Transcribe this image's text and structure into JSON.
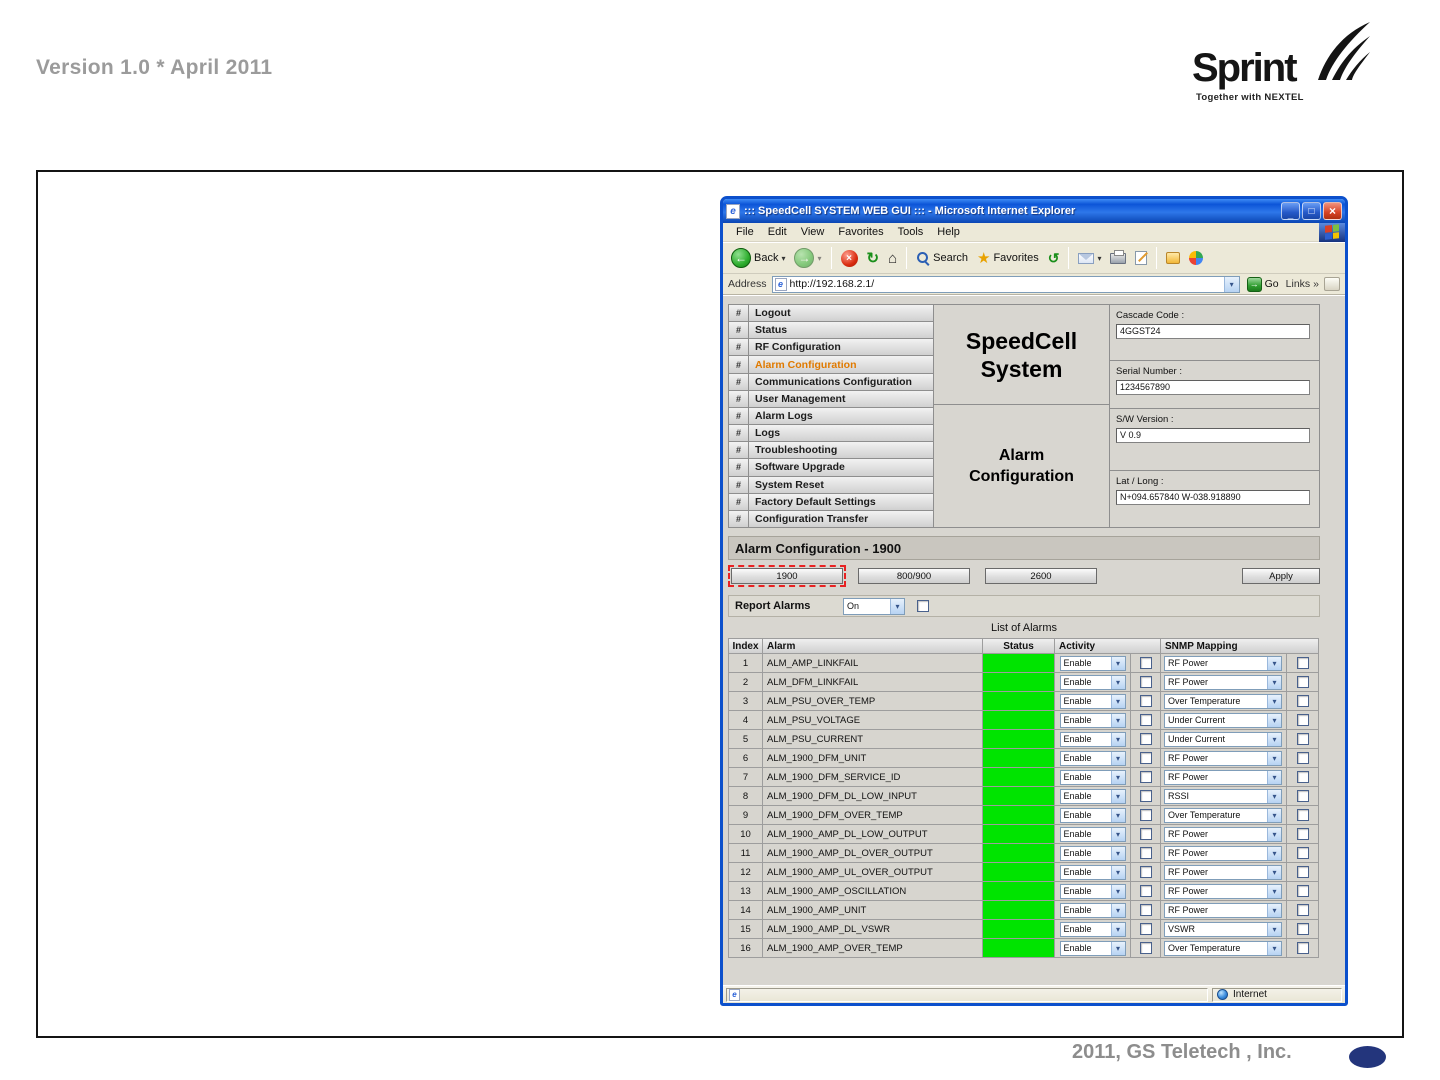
{
  "page": {
    "version_label": "Version 1.0 * April 2011",
    "footer_text": "2011, GS Teletech , Inc.",
    "brand_name": "Sprint",
    "brand_tagline": "Together with NEXTEL"
  },
  "icons": {
    "back_arrow": "←",
    "forward_arrow": "→",
    "stop": "×",
    "refresh": "↻",
    "home": "⌂",
    "favorites_star": "★",
    "history": "↺",
    "dropdown_arrow": "▾",
    "go_arrow": "→",
    "links_chevrons": "»",
    "minimize": "_",
    "maximize": "□",
    "close": "×",
    "ie_letter": "e"
  },
  "browser": {
    "window_title": "::: SpeedCell SYSTEM WEB GUI ::: - Microsoft Internet Explorer",
    "menu_items": [
      "File",
      "Edit",
      "View",
      "Favorites",
      "Tools",
      "Help"
    ],
    "toolbar": {
      "back_label": "Back",
      "search_label": "Search",
      "favorites_label": "Favorites"
    },
    "address_label": "Address",
    "address_url": "http://192.168.2.1/",
    "go_label": "Go",
    "links_label": "Links",
    "status_right": "Internet"
  },
  "nav": {
    "items": [
      {
        "marker": "#",
        "label": "Logout",
        "active": false
      },
      {
        "marker": "#",
        "label": "Status",
        "active": false
      },
      {
        "marker": "#",
        "label": "RF Configuration",
        "active": false
      },
      {
        "marker": "#",
        "label": "Alarm Configuration",
        "active": true
      },
      {
        "marker": "#",
        "label": "Communications Configuration",
        "active": false
      },
      {
        "marker": "#",
        "label": "User Management",
        "active": false
      },
      {
        "marker": "#",
        "label": "Alarm Logs",
        "active": false
      },
      {
        "marker": "#",
        "label": "Logs",
        "active": false
      },
      {
        "marker": "#",
        "label": "Troubleshooting",
        "active": false
      },
      {
        "marker": "#",
        "label": "Software Upgrade",
        "active": false
      },
      {
        "marker": "#",
        "label": "System Reset",
        "active": false
      },
      {
        "marker": "#",
        "label": "Factory Default Settings",
        "active": false
      },
      {
        "marker": "#",
        "label": "Configuration Transfer",
        "active": false
      }
    ]
  },
  "app": {
    "title_line1": "SpeedCell",
    "title_line2": "System",
    "section_line1": "Alarm",
    "section_line2": "Configuration",
    "info_fields": [
      {
        "label": "Cascade Code :",
        "value": "4GGST24"
      },
      {
        "label": "Serial Number :",
        "value": "1234567890"
      },
      {
        "label": "S/W Version :",
        "value": "V 0.9"
      },
      {
        "label": "Lat / Long :",
        "value": "N+094.657840 W-038.918890"
      }
    ]
  },
  "alarm_config": {
    "section_title": "Alarm Configuration - 1900",
    "band_buttons": [
      "1900",
      "800/900",
      "2600"
    ],
    "highlighted_band": "1900",
    "apply_label": "Apply",
    "report_alarms_label": "Report Alarms",
    "report_alarms_value": "On",
    "list_title": "List of Alarms",
    "columns": [
      "Index",
      "Alarm",
      "Status",
      "Activity",
      "SNMP Mapping"
    ],
    "status_color": "#00e400",
    "rows": [
      {
        "index": "1",
        "alarm": "ALM_AMP_LINKFAIL",
        "activity": "Enable",
        "snmp": "RF Power"
      },
      {
        "index": "2",
        "alarm": "ALM_DFM_LINKFAIL",
        "activity": "Enable",
        "snmp": "RF Power"
      },
      {
        "index": "3",
        "alarm": "ALM_PSU_OVER_TEMP",
        "activity": "Enable",
        "snmp": "Over Temperature"
      },
      {
        "index": "4",
        "alarm": "ALM_PSU_VOLTAGE",
        "activity": "Enable",
        "snmp": "Under Current"
      },
      {
        "index": "5",
        "alarm": "ALM_PSU_CURRENT",
        "activity": "Enable",
        "snmp": "Under Current"
      },
      {
        "index": "6",
        "alarm": "ALM_1900_DFM_UNIT",
        "activity": "Enable",
        "snmp": "RF Power"
      },
      {
        "index": "7",
        "alarm": "ALM_1900_DFM_SERVICE_ID",
        "activity": "Enable",
        "snmp": "RF Power"
      },
      {
        "index": "8",
        "alarm": "ALM_1900_DFM_DL_LOW_INPUT",
        "activity": "Enable",
        "snmp": "RSSI"
      },
      {
        "index": "9",
        "alarm": "ALM_1900_DFM_OVER_TEMP",
        "activity": "Enable",
        "snmp": "Over Temperature"
      },
      {
        "index": "10",
        "alarm": "ALM_1900_AMP_DL_LOW_OUTPUT",
        "activity": "Enable",
        "snmp": "RF Power"
      },
      {
        "index": "11",
        "alarm": "ALM_1900_AMP_DL_OVER_OUTPUT",
        "activity": "Enable",
        "snmp": "RF Power"
      },
      {
        "index": "12",
        "alarm": "ALM_1900_AMP_UL_OVER_OUTPUT",
        "activity": "Enable",
        "snmp": "RF Power"
      },
      {
        "index": "13",
        "alarm": "ALM_1900_AMP_OSCILLATION",
        "activity": "Enable",
        "snmp": "RF Power"
      },
      {
        "index": "14",
        "alarm": "ALM_1900_AMP_UNIT",
        "activity": "Enable",
        "snmp": "RF Power"
      },
      {
        "index": "15",
        "alarm": "ALM_1900_AMP_DL_VSWR",
        "activity": "Enable",
        "snmp": "VSWR"
      },
      {
        "index": "16",
        "alarm": "ALM_1900_AMP_OVER_TEMP",
        "activity": "Enable",
        "snmp": "Over Temperature"
      }
    ]
  }
}
